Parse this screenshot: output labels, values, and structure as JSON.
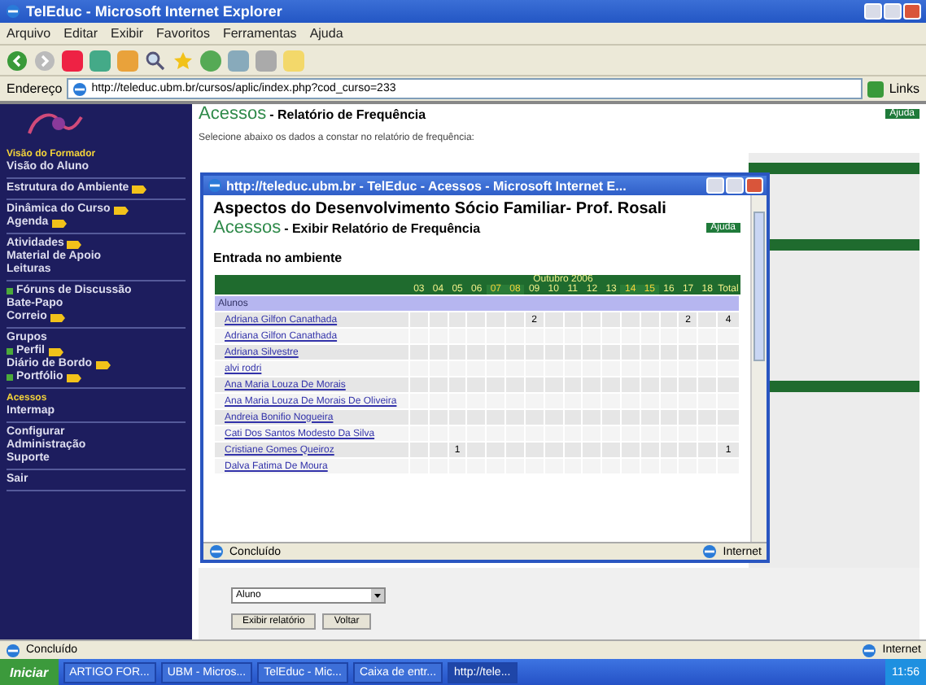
{
  "window": {
    "title": "TelEduc - Microsoft Internet Explorer"
  },
  "menu": [
    "Arquivo",
    "Editar",
    "Exibir",
    "Favoritos",
    "Ferramentas",
    "Ajuda"
  ],
  "address": {
    "label": "Endereço",
    "url": "http://teleduc.ubm.br/cursos/aplic/index.php?cod_curso=233",
    "links": "Links"
  },
  "sidebar": {
    "groups": [
      [
        {
          "label": "Visão do Formador",
          "selected": true
        },
        {
          "label": "Visão do Aluno",
          "selected": false
        }
      ],
      [
        {
          "label": "Estrutura do Ambiente",
          "selected": false,
          "new": true
        }
      ],
      [
        {
          "label": "Dinâmica do Curso",
          "selected": false,
          "new": true
        },
        {
          "label": "Agenda",
          "selected": false,
          "new": true
        }
      ],
      [
        {
          "label": "Atividades",
          "selected": false,
          "new": true
        },
        {
          "label": "Material de Apoio",
          "selected": false
        },
        {
          "label": "Leituras",
          "selected": false
        }
      ],
      [
        {
          "label": "Fóruns de Discussão",
          "selected": false,
          "bullet": true
        },
        {
          "label": "Bate-Papo",
          "selected": false
        },
        {
          "label": "Correio",
          "selected": false,
          "new": true
        }
      ],
      [
        {
          "label": "Grupos",
          "selected": false
        },
        {
          "label": "Perfil",
          "selected": false,
          "bullet": true,
          "new": true
        },
        {
          "label": "Diário de Bordo",
          "selected": false,
          "new": true
        },
        {
          "label": "Portfólio",
          "selected": false,
          "bullet": true,
          "new": true
        }
      ],
      [
        {
          "label": "Acessos",
          "selected": true
        },
        {
          "label": "Intermap",
          "selected": false
        }
      ],
      [
        {
          "label": "Configurar",
          "selected": false
        },
        {
          "label": "Administração",
          "selected": false
        },
        {
          "label": "Suporte",
          "selected": false
        }
      ],
      [
        {
          "label": "Sair",
          "selected": false
        }
      ]
    ]
  },
  "page": {
    "tool": "Acessos",
    "title": " - Relatório de Frequência",
    "help": "Ajuda",
    "instruction": "Selecione abaixo os dados a constar no relatório de frequência:",
    "select": "Aluno",
    "buttons": [
      "Exibir relatório",
      "Voltar"
    ]
  },
  "popup": {
    "title": "http://teleduc.ubm.br - TelEduc - Acessos - Microsoft Internet E...",
    "course": "Aspectos do Desenvolvimento Sócio Familiar- Prof. Rosali",
    "tool": "Acessos",
    "subtitle": " - Exibir Relatório de Frequência",
    "help": "Ajuda",
    "section": "Entrada no ambiente",
    "table": {
      "month": "Outubro 2006",
      "days": [
        {
          "label": "03",
          "weekend": false
        },
        {
          "label": "04",
          "weekend": false
        },
        {
          "label": "05",
          "weekend": false
        },
        {
          "label": "06",
          "weekend": false
        },
        {
          "label": "07",
          "weekend": true
        },
        {
          "label": "08",
          "weekend": true
        },
        {
          "label": "09",
          "weekend": false
        },
        {
          "label": "10",
          "weekend": false
        },
        {
          "label": "11",
          "weekend": false
        },
        {
          "label": "12",
          "weekend": false
        },
        {
          "label": "13",
          "weekend": false
        },
        {
          "label": "14",
          "weekend": true
        },
        {
          "label": "15",
          "weekend": true
        },
        {
          "label": "16",
          "weekend": false
        },
        {
          "label": "17",
          "weekend": false
        },
        {
          "label": "18",
          "weekend": false
        }
      ],
      "total": "Total",
      "group": "Alunos",
      "rows": [
        {
          "name": "Adriana Gilfon Canathada",
          "cells": [
            {
              "kind": "blank"
            },
            {
              "kind": "blank"
            },
            {
              "kind": "blank"
            },
            {
              "kind": "blank"
            },
            {
              "kind": "blank"
            },
            {
              "kind": "blank"
            },
            {
              "kind": "count",
              "text": "2"
            },
            {
              "kind": "blank"
            },
            {
              "kind": "blank"
            },
            {
              "kind": "blank"
            },
            {
              "kind": "blank"
            },
            {
              "kind": "blank"
            },
            {
              "kind": "blank"
            },
            {
              "kind": "blank"
            },
            {
              "kind": "count",
              "text": "2"
            },
            {
              "kind": "blank"
            }
          ],
          "total": "4"
        },
        {
          "name": "Adriana Gilfon Canathada"
        },
        {
          "name": "Adriana Silvestre"
        },
        {
          "name": "alvi rodri"
        },
        {
          "name": "Ana Maria Louza De Morais"
        },
        {
          "name": "Ana Maria Louza De Morais De Oliveira"
        },
        {
          "name": "Andreia Bonifio Nogueira"
        },
        {
          "name": "Cati Dos Santos Modesto Da Silva"
        },
        {
          "name": "Cristiane Gomes Queiroz",
          "cells": [
            {
              "kind": "blank"
            },
            {
              "kind": "blank"
            },
            {
              "kind": "count",
              "text": "1"
            },
            {
              "kind": "blank"
            },
            {
              "kind": "blank"
            },
            {
              "kind": "blank"
            },
            {
              "kind": "blank"
            },
            {
              "kind": "blank"
            },
            {
              "kind": "blank"
            },
            {
              "kind": "blank"
            },
            {
              "kind": "blank"
            },
            {
              "kind": "blank"
            },
            {
              "kind": "blank"
            },
            {
              "kind": "blank"
            },
            {
              "kind": "blank"
            },
            {
              "kind": "blank"
            }
          ],
          "total": "1"
        },
        {
          "name": "Dalva Fatima De Moura"
        }
      ]
    },
    "status": "Concluído",
    "zone": "Internet"
  },
  "status_bar": {
    "text": "Concluído",
    "zone": "Internet"
  },
  "taskbar": {
    "start": "Iniciar",
    "tasks": [
      {
        "label": "ARTIGO FOR...",
        "selected": false
      },
      {
        "label": "UBM - Micros...",
        "selected": false
      },
      {
        "label": "TelEduc - Mic...",
        "selected": false
      },
      {
        "label": "Caixa de entr...",
        "selected": false
      },
      {
        "label": "http://tele...",
        "selected": true
      }
    ],
    "clock": "11:56"
  }
}
